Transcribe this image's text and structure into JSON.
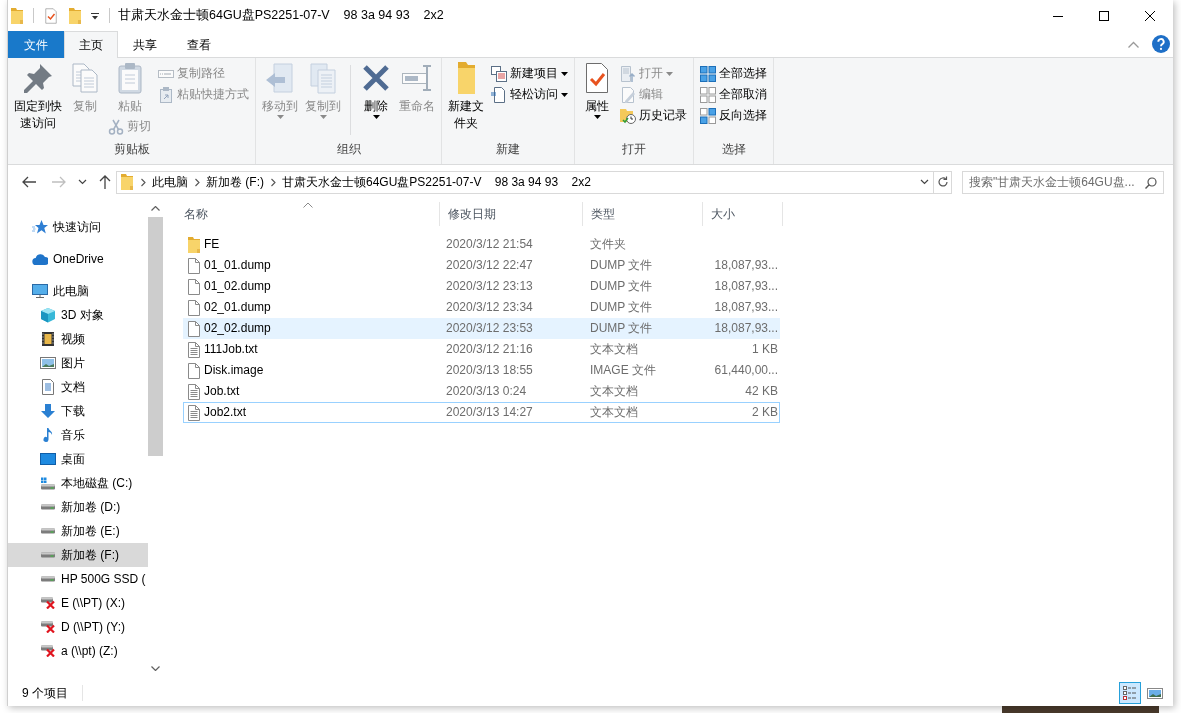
{
  "window": {
    "title": "甘肃天水金士顿64GU盘PS2251-07-V    98 3a 94 93    2x2"
  },
  "ribbon": {
    "tabs": [
      {
        "label": "文件",
        "kind": "menu",
        "selected": false
      },
      {
        "label": "主页",
        "kind": "tab",
        "selected": true
      },
      {
        "label": "共享",
        "kind": "tab",
        "selected": false
      },
      {
        "label": "查看",
        "kind": "tab",
        "selected": false
      }
    ],
    "groups": [
      {
        "label": "剪贴板",
        "columns": [
          {
            "kind": "stack",
            "buttons": [
              {
                "label": "固定到快速访问",
                "kind": "pin",
                "large": true,
                "disabled": false,
                "dropdown": false
              }
            ]
          },
          {
            "kind": "stack",
            "buttons": [
              {
                "label": "复制",
                "kind": "copy",
                "large": true,
                "disabled": true,
                "dropdown": false
              }
            ]
          },
          {
            "kind": "stack",
            "buttons": [
              {
                "label": "粘贴",
                "kind": "paste",
                "large": true,
                "disabled": true,
                "dropdown": false
              },
              {
                "label": "剪切",
                "kind": "cut",
                "large": false,
                "disabled": true,
                "dropdown": false
              }
            ]
          },
          {
            "kind": "stack",
            "buttons": [
              {
                "label": "复制路径",
                "kind": "copy_path",
                "large": false,
                "disabled": true,
                "dropdown": false
              },
              {
                "label": "粘贴快捷方式",
                "kind": "paste_shortcut",
                "large": false,
                "disabled": true,
                "dropdown": false
              }
            ]
          }
        ]
      },
      {
        "label": "组织",
        "columns": [
          {
            "kind": "stack",
            "buttons": [
              {
                "label": "移动到",
                "kind": "move_to",
                "large": true,
                "disabled": true,
                "dropdown": true
              }
            ]
          },
          {
            "kind": "stack",
            "buttons": [
              {
                "label": "复制到",
                "kind": "copy_to",
                "large": true,
                "disabled": true,
                "dropdown": true
              }
            ]
          },
          {
            "kind": "separator"
          },
          {
            "kind": "stack",
            "buttons": [
              {
                "label": "删除",
                "kind": "delete",
                "large": true,
                "disabled": false,
                "dropdown": true
              }
            ]
          },
          {
            "kind": "stack",
            "buttons": [
              {
                "label": "重命名",
                "kind": "rename",
                "large": true,
                "disabled": true,
                "dropdown": false
              }
            ]
          }
        ]
      },
      {
        "label": "新建",
        "columns": [
          {
            "kind": "stack",
            "buttons": [
              {
                "label": "新建文件夹",
                "kind": "new_folder",
                "large": true,
                "disabled": false,
                "dropdown": false
              }
            ]
          },
          {
            "kind": "stack",
            "buttons": [
              {
                "label": "新建项目",
                "kind": "new_item",
                "large": false,
                "disabled": false,
                "dropdown": true
              },
              {
                "label": "轻松访问",
                "kind": "easy_access",
                "large": false,
                "disabled": false,
                "dropdown": true
              }
            ]
          }
        ]
      },
      {
        "label": "打开",
        "columns": [
          {
            "kind": "stack",
            "buttons": [
              {
                "label": "属性",
                "kind": "properties",
                "large": true,
                "disabled": false,
                "dropdown": true
              }
            ]
          },
          {
            "kind": "stack",
            "buttons": [
              {
                "label": "打开",
                "kind": "open",
                "large": false,
                "disabled": true,
                "dropdown": true
              },
              {
                "label": "编辑",
                "kind": "edit",
                "large": false,
                "disabled": true,
                "dropdown": false
              },
              {
                "label": "历史记录",
                "kind": "history",
                "large": false,
                "disabled": false,
                "dropdown": false
              }
            ]
          }
        ]
      },
      {
        "label": "选择",
        "columns": [
          {
            "kind": "stack",
            "buttons": [
              {
                "label": "全部选择",
                "kind": "select_all",
                "large": false,
                "disabled": false,
                "dropdown": false
              },
              {
                "label": "全部取消",
                "kind": "select_none",
                "large": false,
                "disabled": false,
                "dropdown": false
              },
              {
                "label": "反向选择",
                "kind": "invert_selection",
                "large": false,
                "disabled": false,
                "dropdown": false
              }
            ]
          }
        ]
      }
    ]
  },
  "address_bar": {
    "buttons": [
      {
        "kind": "back",
        "disabled": false
      },
      {
        "kind": "forward",
        "disabled": true
      },
      {
        "kind": "recent",
        "disabled": false
      },
      {
        "kind": "up",
        "disabled": false
      }
    ],
    "path": [
      "此电脑",
      "新加卷 (F:)",
      "甘肃天水金士顿64GU盘PS2251-07-V    98 3a 94 93    2x2"
    ]
  },
  "search": {
    "placeholder": "搜索\"甘肃天水金士顿64GU盘..."
  },
  "navigation_pane": {
    "items": [
      {
        "label": "快速访问",
        "kind": "quick_access",
        "selected": false
      },
      {
        "label": "OneDrive",
        "kind": "cloud",
        "selected": false
      },
      {
        "label": "此电脑",
        "kind": "computer",
        "selected": false,
        "children": [
          {
            "label": "3D 对象",
            "kind": "objects3d",
            "selected": false
          },
          {
            "label": "视频",
            "kind": "videos",
            "selected": false
          },
          {
            "label": "图片",
            "kind": "pictures",
            "selected": false
          },
          {
            "label": "文档",
            "kind": "documents",
            "selected": false
          },
          {
            "label": "下载",
            "kind": "downloads",
            "selected": false
          },
          {
            "label": "音乐",
            "kind": "music",
            "selected": false
          },
          {
            "label": "桌面",
            "kind": "desktop",
            "selected": false
          },
          {
            "label": "本地磁盘 (C:)",
            "kind": "system_drive",
            "selected": false
          },
          {
            "label": "新加卷 (D:)",
            "kind": "drive",
            "selected": false
          },
          {
            "label": "新加卷 (E:)",
            "kind": "drive",
            "selected": false
          },
          {
            "label": "新加卷 (F:)",
            "kind": "drive",
            "selected": true
          },
          {
            "label": "HP 500G SSD (",
            "kind": "drive",
            "selected": false
          },
          {
            "label": "E (\\\\PT) (X:)",
            "kind": "network_offline",
            "selected": false
          },
          {
            "label": "D (\\\\PT) (Y:)",
            "kind": "network_offline",
            "selected": false
          },
          {
            "label": "a (\\\\pt) (Z:)",
            "kind": "network_offline",
            "selected": false
          }
        ]
      }
    ]
  },
  "file_list": {
    "columns": [
      {
        "label": "名称",
        "sorted": true
      },
      {
        "label": "修改日期",
        "sorted": false
      },
      {
        "label": "类型",
        "sorted": false
      },
      {
        "label": "大小",
        "sorted": false
      }
    ],
    "rows": [
      {
        "kind": "folder",
        "name": "FE",
        "modified": "2020/3/12 21:54",
        "type": "文件夹",
        "hovered": false,
        "focused": false
      },
      {
        "kind": "file",
        "name": "01_01.dump",
        "modified": "2020/3/12 22:47",
        "type": "DUMP 文件",
        "size": "18,087,93...",
        "hovered": false,
        "focused": false
      },
      {
        "kind": "file",
        "name": "01_02.dump",
        "modified": "2020/3/12 23:13",
        "type": "DUMP 文件",
        "size": "18,087,93...",
        "hovered": false,
        "focused": false
      },
      {
        "kind": "file",
        "name": "02_01.dump",
        "modified": "2020/3/12 23:34",
        "type": "DUMP 文件",
        "size": "18,087,93...",
        "hovered": false,
        "focused": false
      },
      {
        "kind": "file",
        "name": "02_02.dump",
        "modified": "2020/3/12 23:53",
        "type": "DUMP 文件",
        "size": "18,087,93...",
        "hovered": true,
        "focused": false
      },
      {
        "kind": "text",
        "name": "111Job.txt",
        "modified": "2020/3/12 21:16",
        "type": "文本文档",
        "size": "1 KB",
        "hovered": false,
        "focused": false
      },
      {
        "kind": "file",
        "name": "Disk.image",
        "modified": "2020/3/13 18:55",
        "type": "IMAGE 文件",
        "size": "61,440,00...",
        "hovered": false,
        "focused": false
      },
      {
        "kind": "text",
        "name": "Job.txt",
        "modified": "2020/3/13 0:24",
        "type": "文本文档",
        "size": "42 KB",
        "hovered": false,
        "focused": false
      },
      {
        "kind": "text",
        "name": "Job2.txt",
        "modified": "2020/3/13 14:27",
        "type": "文本文档",
        "size": "2 KB",
        "hovered": false,
        "focused": true
      }
    ]
  },
  "status_bar": {
    "item_count": "9 个项目",
    "views": [
      {
        "kind": "details",
        "selected": true
      },
      {
        "kind": "large_icons",
        "selected": false
      }
    ]
  }
}
